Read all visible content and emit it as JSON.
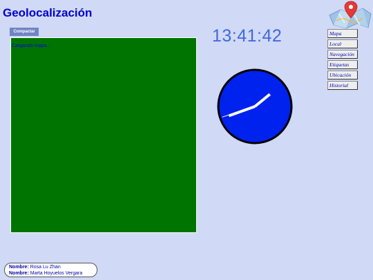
{
  "header": {
    "title": "Geolocalización"
  },
  "toolbar": {
    "compact_label": "Compactar"
  },
  "map": {
    "loading_text": "Cargando mapa..."
  },
  "clock": {
    "time_text": "13:41:42",
    "hours": 13,
    "minutes": 41,
    "seconds": 42,
    "face_color": "#0022ee",
    "rim_color": "#000000",
    "hand_color": "#ffffff"
  },
  "nav": {
    "items": [
      {
        "label": "Mapa"
      },
      {
        "label": "Local"
      },
      {
        "label": "Navegación"
      },
      {
        "label": "Etiquetas"
      },
      {
        "label": "Ubicación"
      },
      {
        "label": "Historial"
      }
    ]
  },
  "footer": {
    "authors": [
      {
        "label": "Nombre:",
        "name": "Rosa Lu Zhan"
      },
      {
        "label": "Nombre:",
        "name": "Marta Hoyuelos Vergara"
      }
    ]
  },
  "logo": {
    "icon": "map-pin-icon"
  },
  "colors": {
    "background": "#d0d9f5",
    "title": "#0000cc",
    "map": "#007400",
    "button": "#6f86c4",
    "digital_clock": "#4169e1"
  }
}
